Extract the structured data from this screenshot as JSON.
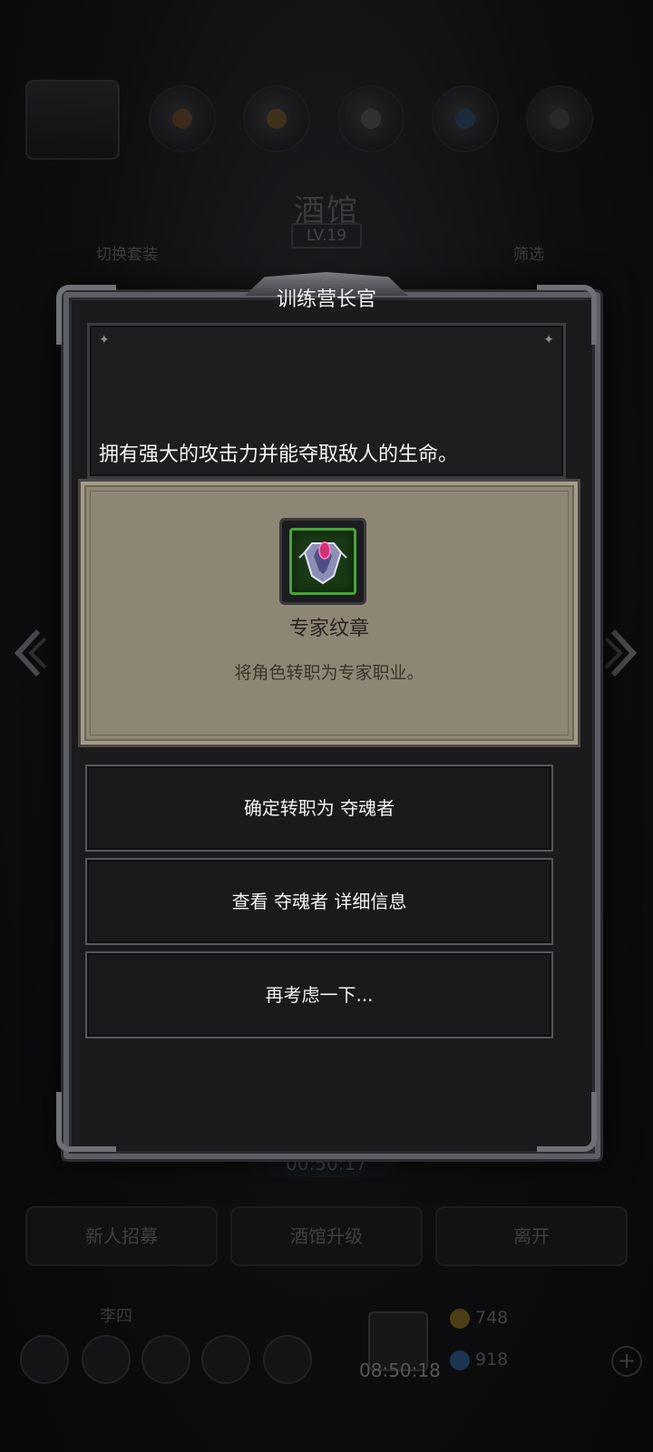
{
  "background": {
    "title": "酒馆",
    "level": "LV.19",
    "left_label": "切换套装",
    "right_label": "筛选",
    "timer": "00:50:17",
    "buttons": [
      "新人招募",
      "酒馆升级",
      "离开"
    ],
    "username": "李四",
    "clock": "08:50:18",
    "gold": "748",
    "gems": "918"
  },
  "dialog": {
    "title": "训练营长官",
    "description": "拥有强大的攻击力并能夺取敌人的生命。",
    "item": {
      "name": "专家纹章",
      "description": "将角色转职为专家职业。",
      "icon": "emblem-icon"
    },
    "options": [
      "确定转职为 夺魂者",
      "查看 夺魂者 详细信息",
      "再考虑一下..."
    ]
  },
  "colors": {
    "item_card_bg": "#8e8674",
    "icon_border": "#4aa33a",
    "frame": "#5c5e63"
  }
}
